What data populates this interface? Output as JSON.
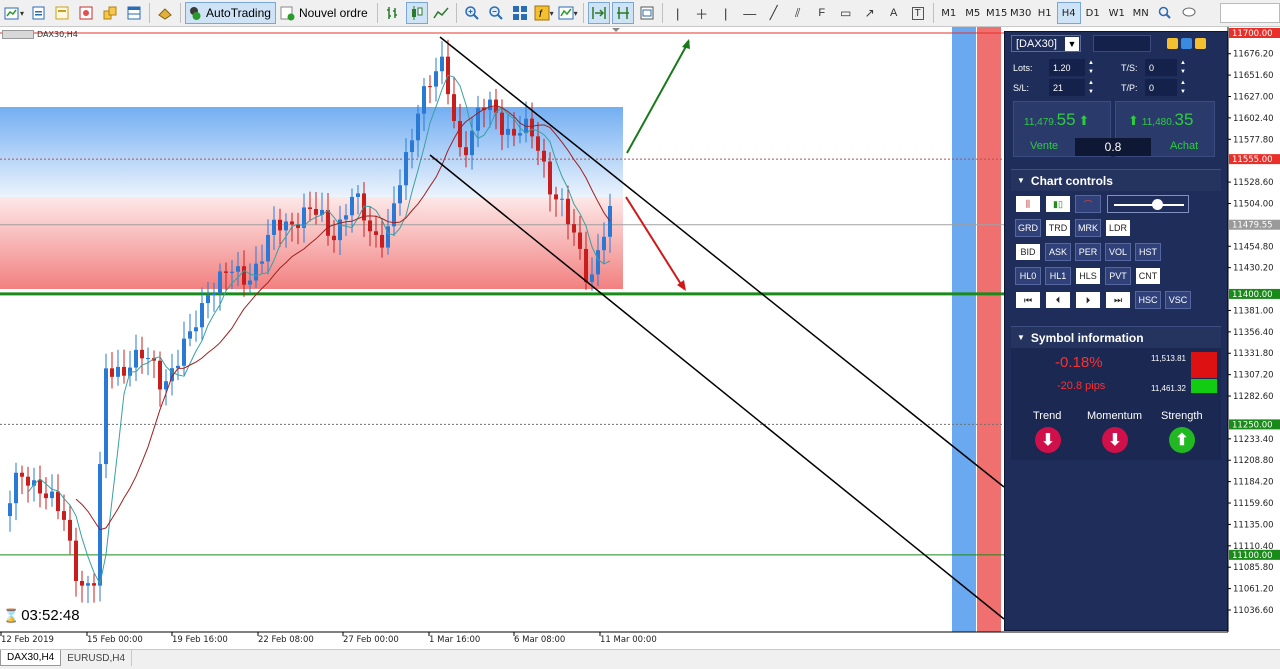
{
  "toolbar": {
    "autotrading_label": "AutoTrading",
    "new_order_label": "Nouvel ordre",
    "timeframes": [
      "M1",
      "M5",
      "M15",
      "M30",
      "H1",
      "H4",
      "D1",
      "W1",
      "MN"
    ],
    "active_timeframe": "H4"
  },
  "chart": {
    "title": "DAX30,H4",
    "countdown": "03:52:48",
    "price_labels": [
      "11676.20",
      "11651.60",
      "11627.00",
      "11602.40",
      "11577.80",
      "11528.60",
      "11504.00",
      "11454.80",
      "11430.20",
      "11381.00",
      "11356.40",
      "11331.80",
      "11307.20",
      "11282.60",
      "11233.40",
      "11208.80",
      "11184.20",
      "11159.60",
      "11135.00",
      "11110.40",
      "11085.80",
      "11061.20",
      "11036.60"
    ],
    "highlighted_levels": [
      {
        "label": "11700.00",
        "color": "#e8302a"
      },
      {
        "label": "11555.00",
        "color": "#e8302a"
      },
      {
        "label": "11479.55",
        "color": "#9a9a9a"
      },
      {
        "label": "11400.00",
        "color": "#1a8a1a"
      },
      {
        "label": "11250.00",
        "color": "#1a8a1a"
      },
      {
        "label": "11100.00",
        "color": "#1a8a1a"
      }
    ],
    "time_labels": [
      "12 Feb 2019",
      "15 Feb 00:00",
      "19 Feb 16:00",
      "22 Feb 08:00",
      "27 Feb 00:00",
      "1 Mar 16:00",
      "6 Mar 08:00",
      "11 Mar 00:00"
    ]
  },
  "panel": {
    "symbol": "[DAX30]",
    "lots_label": "Lots:",
    "lots_value": "1.20",
    "sl_label": "S/L:",
    "sl_value": "21",
    "ts_label": "T/S:",
    "ts_value": "0",
    "tp_label": "T/P:",
    "tp_value": "0",
    "sell_price_main": "11,479.",
    "sell_price_big": "55",
    "buy_price_main": "11,480.",
    "buy_price_big": "35",
    "sell_label": "Vente",
    "buy_label": "Achat",
    "spread": "0.8",
    "chart_controls_title": "Chart controls",
    "buttons_row1": [
      "GRD",
      "TRD",
      "MRK",
      "LDR"
    ],
    "buttons_row2": [
      "BID",
      "ASK",
      "PER",
      "VOL",
      "HST"
    ],
    "buttons_row3": [
      "HL0",
      "HL1",
      "HLS",
      "PVT",
      "CNT"
    ],
    "buttons_row4": [
      "HSC",
      "VSC"
    ],
    "symbol_info_title": "Symbol information",
    "change_pct": "-0.18%",
    "change_pips": "-20.8 pips",
    "high_value": "11,513.81",
    "low_value": "11,461.32",
    "trend_label": "Trend",
    "momentum_label": "Momentum",
    "strength_label": "Strength"
  },
  "tabs": [
    "DAX30,H4",
    "EURUSD,H4"
  ]
}
